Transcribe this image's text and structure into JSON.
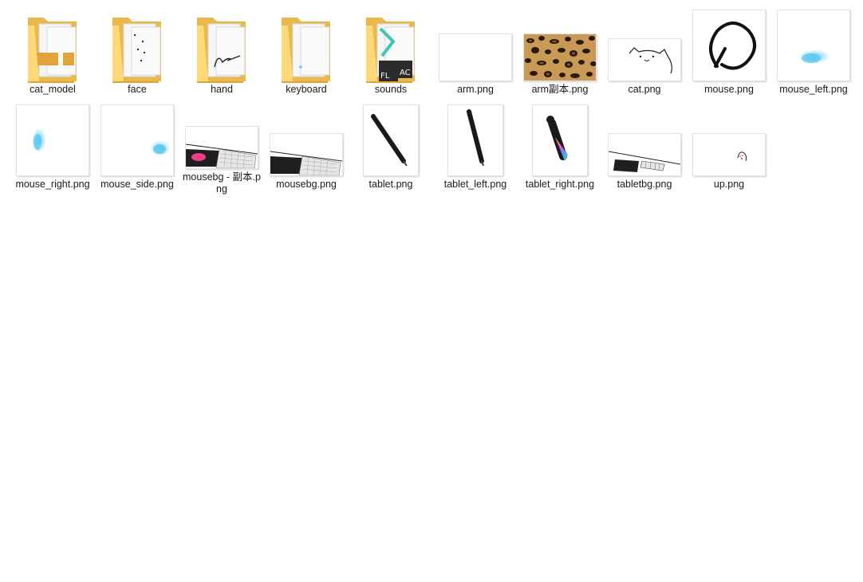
{
  "items_row1": [
    {
      "label": "cat_model",
      "kind": "folder",
      "icon": "folder-json-icon"
    },
    {
      "label": "face",
      "kind": "folder",
      "icon": "folder-face-icon"
    },
    {
      "label": "hand",
      "kind": "folder",
      "icon": "folder-hand-icon"
    },
    {
      "label": "keyboard",
      "kind": "folder",
      "icon": "folder-keyboard-icon"
    },
    {
      "label": "sounds",
      "kind": "folder",
      "icon": "folder-flac-icon"
    },
    {
      "label": "arm.png",
      "kind": "image",
      "icon": "blank-image-icon"
    },
    {
      "label": "arm副本.png",
      "kind": "image",
      "icon": "leopard-pattern-icon"
    },
    {
      "label": "cat.png",
      "kind": "image",
      "icon": "cat-outline-icon"
    },
    {
      "label": "mouse.png",
      "kind": "image",
      "icon": "circle-scribble-icon"
    },
    {
      "label": "mouse_left.png",
      "kind": "image",
      "icon": "blue-blob-icon"
    }
  ],
  "items_row2": [
    {
      "label": "mouse_right.png",
      "kind": "image",
      "icon": "blue-blob-icon"
    },
    {
      "label": "mouse_side.png",
      "kind": "image",
      "icon": "blue-blob-icon"
    },
    {
      "label": "mousebg - 副本.png",
      "kind": "image",
      "icon": "desk-mousepad-icon"
    },
    {
      "label": "mousebg.png",
      "kind": "image",
      "icon": "desk-mousepad-icon"
    },
    {
      "label": "tablet.png",
      "kind": "image",
      "icon": "stylus-pen-icon"
    },
    {
      "label": "tablet_left.png",
      "kind": "image",
      "icon": "stylus-pen-icon"
    },
    {
      "label": "tablet_right.png",
      "kind": "image",
      "icon": "rainbow-pen-icon"
    },
    {
      "label": "tabletbg.png",
      "kind": "image",
      "icon": "desk-tablet-icon"
    },
    {
      "label": "up.png",
      "kind": "image",
      "icon": "paw-icon"
    }
  ],
  "colors": {
    "folder_back": "#e8b94a",
    "folder_front": "#ffd977",
    "json_badge": "#e2a43a",
    "blue_blob": "#5bc8f0",
    "teal_arrow": "#3cc7b0"
  }
}
